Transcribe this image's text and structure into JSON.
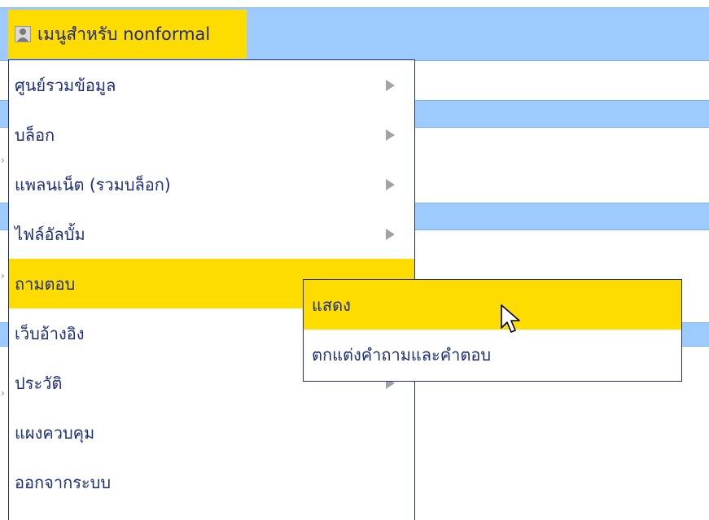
{
  "header": {
    "menu_title": "เมนูสำหรับ nonformal",
    "icon": "user-icon"
  },
  "menu": {
    "items": [
      {
        "label": "ศูนย์รวมข้อมูล",
        "has_submenu": true
      },
      {
        "label": "บล็อก",
        "has_submenu": true
      },
      {
        "label": "แพลนเน็ต (รวมบล็อก)",
        "has_submenu": true
      },
      {
        "label": "ไฟล์อัลบั้ม",
        "has_submenu": true
      },
      {
        "label": "ถามตอบ",
        "has_submenu": false,
        "active": true
      },
      {
        "label": "เว็บอ้างอิง",
        "has_submenu": false
      },
      {
        "label": "ประวัติ",
        "has_submenu": true
      },
      {
        "label": "แผงควบคุม",
        "has_submenu": false
      },
      {
        "label": "ออกจากระบบ",
        "has_submenu": false
      }
    ]
  },
  "submenu": {
    "items": [
      {
        "label": "แสดง",
        "active": true
      },
      {
        "label": "ตกแต่งคำถามและคำตอบ",
        "active": false
      }
    ]
  },
  "colors": {
    "highlight": "#ffdc00",
    "background_bar": "#9ecbff",
    "menu_text": "#1c2f7a",
    "border": "#1f2f80"
  }
}
